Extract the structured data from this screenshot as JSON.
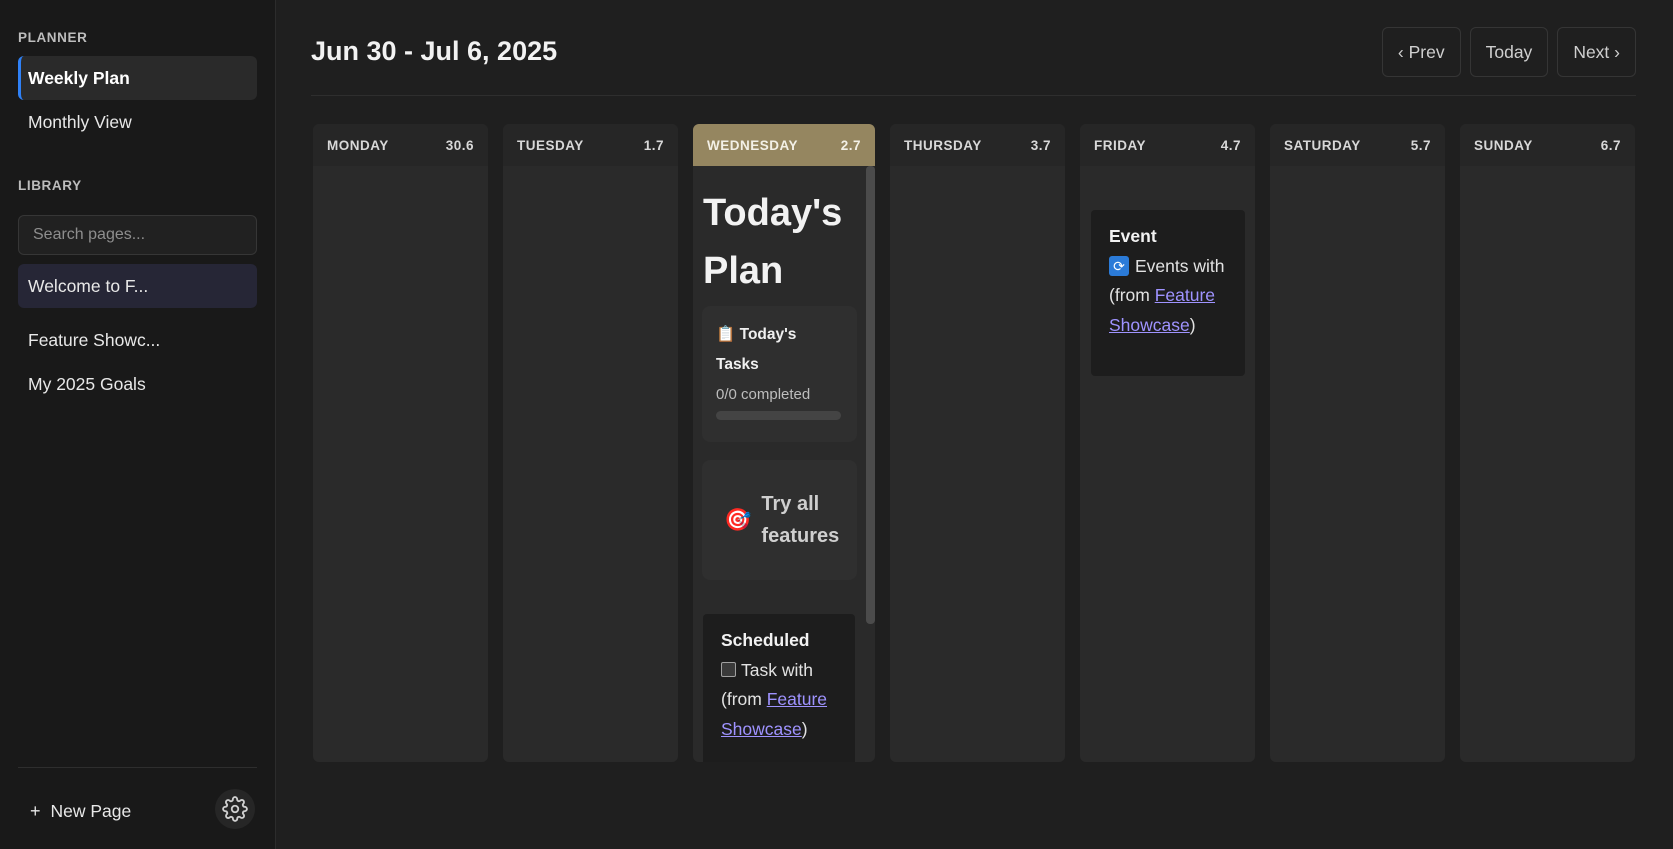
{
  "sidebar": {
    "planner_title": "PLANNER",
    "planner_items": [
      "Weekly Plan",
      "Monthly View"
    ],
    "library_title": "LIBRARY",
    "search_placeholder": "Search pages...",
    "library_items": [
      "Welcome to F...",
      "Feature Showc...",
      "My 2025 Goals"
    ],
    "new_page_label": "New Page",
    "new_page_symbol": "+",
    "settings_icon": "gear-icon"
  },
  "header": {
    "week_title": "Jun 30 - Jul 6, 2025",
    "prev_label": "‹ Prev",
    "today_label": "Today",
    "next_label": "Next ›"
  },
  "days": [
    {
      "name": "MONDAY",
      "date": "30.6"
    },
    {
      "name": "TUESDAY",
      "date": "1.7"
    },
    {
      "name": "WEDNESDAY",
      "date": "2.7"
    },
    {
      "name": "THURSDAY",
      "date": "3.7"
    },
    {
      "name": "FRIDAY",
      "date": "4.7"
    },
    {
      "name": "SATURDAY",
      "date": "5.7"
    },
    {
      "name": "SUNDAY",
      "date": "6.7"
    }
  ],
  "today_panel": {
    "title": "Today's Plan",
    "tasks_widget": {
      "icon": "📋",
      "title": "Today's Tasks",
      "count_text": "0/0 completed",
      "progress": 0
    },
    "features_widget": {
      "icon": "🎯",
      "label": "Try all features"
    },
    "scheduled_card": {
      "title": "Scheduled",
      "text_prefix": "Task with (from ",
      "link": "Feature Showcase",
      "text_suffix": ")"
    }
  },
  "friday_event": {
    "title": "Event",
    "icon": "🔁",
    "text_prefix": "Events with (from ",
    "link": "Feature Showcase",
    "text_suffix": ")"
  },
  "colors": {
    "accent": "#2f81f7",
    "today_header": "#958660",
    "link": "#9f93ff",
    "background": "#1f1f1f"
  }
}
